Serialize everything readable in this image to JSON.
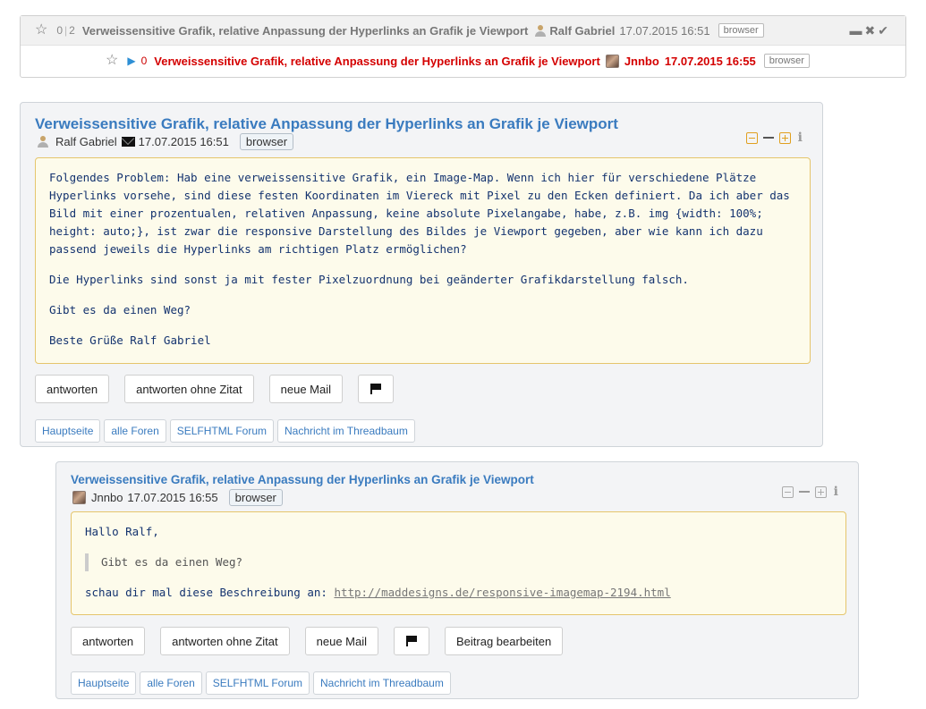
{
  "tree": {
    "root": {
      "count_a": "0",
      "count_b": "2",
      "title": "Verweissensitive Grafik, relative Anpassung der Hyperlinks an Grafik je Viewport",
      "author": "Ralf Gabriel",
      "date": "17.07.2015 16:51",
      "tag": "browser"
    },
    "reply": {
      "count": "0",
      "title": "Verweissensitive Grafik, relative Anpassung der Hyperlinks an Grafik je Viewport",
      "author": "Jnnbo",
      "date": "17.07.2015 16:55",
      "tag": "browser"
    }
  },
  "message1": {
    "title": "Verweissensitive Grafik, relative Anpassung der Hyperlinks an Grafik je Viewport",
    "author": "Ralf Gabriel",
    "date": "17.07.2015 16:51",
    "tag": "browser",
    "paragraphs": [
      "Folgendes Problem: Hab eine verweissensitive Grafik, ein Image-Map. Wenn ich hier für verschiedene Plätze Hyperlinks vorsehe, sind diese festen Koordinaten im Viereck mit Pixel zu den Ecken definiert. Da ich aber das Bild mit einer prozentualen, relativen Anpassung, keine absolute Pixelangabe, habe, z.B. img {width: 100%; height: auto;}, ist zwar die responsive Darstellung des Bildes je Viewport gegeben, aber wie kann ich dazu passend jeweils die Hyperlinks am richtigen Platz ermöglichen?",
      "Die Hyperlinks sind sonst ja mit fester Pixelzuordnung bei geänderter Grafikdarstellung falsch.",
      "Gibt es da einen Weg?",
      "Beste Grüße Ralf Gabriel"
    ],
    "buttons": {
      "reply": "antworten",
      "reply_no_quote": "antworten ohne Zitat",
      "new_mail": "neue Mail"
    }
  },
  "message2": {
    "title": "Verweissensitive Grafik, relative Anpassung der Hyperlinks an Grafik je Viewport",
    "author": "Jnnbo",
    "date": "17.07.2015 16:55",
    "tag": "browser",
    "greeting": "Hallo Ralf,",
    "quote": "Gibt es da einen Weg?",
    "text": "schau dir mal diese Beschreibung an: ",
    "link": "http://maddesigns.de/responsive-imagemap-2194.html",
    "buttons": {
      "reply": "antworten",
      "reply_no_quote": "antworten ohne Zitat",
      "new_mail": "neue Mail",
      "edit": "Beitrag bearbeiten"
    }
  },
  "breadcrumbs": [
    "Hauptseite",
    "alle Foren",
    "SELFHTML Forum",
    "Nachricht im Threadbaum"
  ],
  "icons": {
    "star": "star-outline-icon",
    "folder": "folder-open-icon",
    "close": "close-icon",
    "check": "check-icon"
  }
}
